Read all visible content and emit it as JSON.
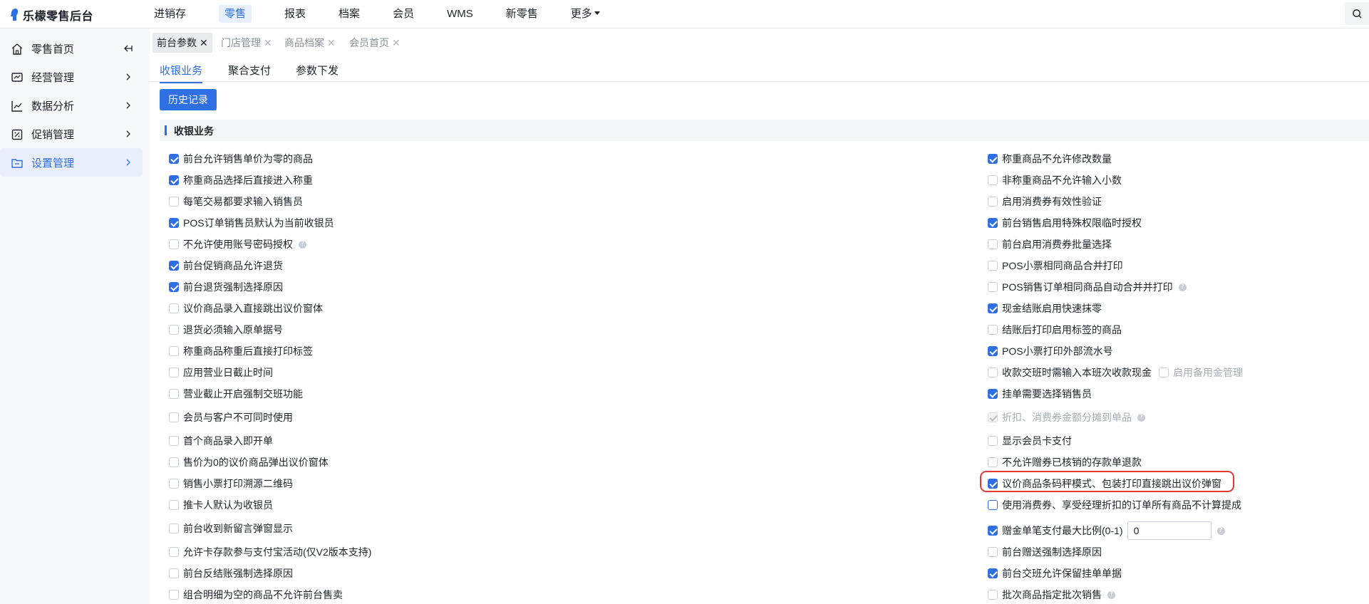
{
  "app": {
    "title": "乐檬零售后台"
  },
  "top_nav": [
    {
      "label": "进销存",
      "active": false
    },
    {
      "label": "零售",
      "active": true
    },
    {
      "label": "报表",
      "active": false
    },
    {
      "label": "档案",
      "active": false
    },
    {
      "label": "会员",
      "active": false
    },
    {
      "label": "WMS",
      "active": false
    },
    {
      "label": "新零售",
      "active": false
    },
    {
      "label": "更多",
      "active": false
    }
  ],
  "sidebar": {
    "items": [
      {
        "label": "零售首页",
        "icon": "home-icon",
        "active": false
      },
      {
        "label": "经营管理",
        "icon": "dashboard-icon",
        "active": false
      },
      {
        "label": "数据分析",
        "icon": "trend-chart-icon",
        "active": false
      },
      {
        "label": "促销管理",
        "icon": "promotion-icon",
        "active": false
      },
      {
        "label": "设置管理",
        "icon": "folder-settings-icon",
        "active": true
      }
    ]
  },
  "tabs": [
    {
      "label": "前台参数",
      "active": true
    },
    {
      "label": "门店管理",
      "active": false
    },
    {
      "label": "商品档案",
      "active": false
    },
    {
      "label": "会员首页",
      "active": false
    }
  ],
  "sub_tabs": [
    {
      "label": "收银业务",
      "active": true
    },
    {
      "label": "聚合支付",
      "active": false
    },
    {
      "label": "参数下发",
      "active": false
    }
  ],
  "history_button": "历史记录",
  "section_title": "收银业务",
  "left_options": [
    {
      "label": "前台允许销售单价为零的商品",
      "checked": true
    },
    {
      "label": "称重商品选择后直接进入称重",
      "checked": true
    },
    {
      "label": "每笔交易都要求输入销售员",
      "checked": false
    },
    {
      "label": "POS订单销售员默认为当前收银员",
      "checked": true
    },
    {
      "label": "不允许使用账号密码授权",
      "checked": false,
      "help": "?"
    },
    {
      "label": "前台促销商品允许退货",
      "checked": true
    },
    {
      "label": "前台退货强制选择原因",
      "checked": true
    },
    {
      "label": "议价商品录入直接跳出议价窗体",
      "checked": false
    },
    {
      "label": "退货必须输入原单据号",
      "checked": false
    },
    {
      "label": "称重商品称重后直接打印标签",
      "checked": false
    },
    {
      "label": "应用营业日截止时间",
      "checked": false
    },
    {
      "label": "营业截止开启强制交班功能",
      "checked": false
    },
    {
      "label": "会员与客户不可同时使用",
      "checked": false
    },
    {
      "label": "首个商品录入即开单",
      "checked": false
    },
    {
      "label": "售价为0的议价商品弹出议价窗体",
      "checked": false
    },
    {
      "label": "销售小票打印溯源二维码",
      "checked": false
    },
    {
      "label": "推卡人默认为收银员",
      "checked": false
    },
    {
      "label": "前台收到新留言弹窗显示",
      "checked": false
    },
    {
      "label": "允许卡存款参与支付宝活动(仅V2版本支持)",
      "checked": false
    },
    {
      "label": "前台反结账强制选择原因",
      "checked": false
    },
    {
      "label": "组合明细为空的商品不允许前台售卖",
      "checked": false
    }
  ],
  "right_options": [
    {
      "label": "称重商品不允许修改数量",
      "checked": true
    },
    {
      "label": "非称重商品不允许输入小数",
      "checked": false
    },
    {
      "label": "启用消费券有效性验证",
      "checked": false
    },
    {
      "label": "前台销售启用特殊权限临时授权",
      "checked": true
    },
    {
      "label": "前台启用消费券批量选择",
      "checked": false
    },
    {
      "label": "POS小票相同商品合并打印",
      "checked": false
    },
    {
      "label": "POS销售订单相同商品自动合并并打印",
      "checked": false,
      "help": "?"
    },
    {
      "label": "现金结账启用快速抹零",
      "checked": true
    },
    {
      "label": "结账后打印启用标签的商品",
      "checked": false
    },
    {
      "label": "POS小票打印外部流水号",
      "checked": true
    },
    {
      "label": "收款交班时需输入本班次收款现金",
      "checked": false,
      "sub_label": "启用备用金管理"
    },
    {
      "label": "挂单需要选择销售员",
      "checked": true
    },
    {
      "label": "折扣、消费券金额分摊到单品",
      "checked": true,
      "disabled": true,
      "help": "?"
    },
    {
      "label": "显示会员卡支付",
      "checked": false
    },
    {
      "label": "不允许赠券已核销的存款单退款",
      "checked": false
    },
    {
      "label": "议价商品条码秤模式、包装打印直接跳出议价弹窗",
      "checked": true,
      "highlighted": true
    },
    {
      "label": "使用消费券、享受经理折扣的订单所有商品不计算提成",
      "checked": false,
      "focused": true
    },
    {
      "label": "赠金单笔支付最大比例(0-1)",
      "checked": true,
      "input_value": "0",
      "help": "?"
    },
    {
      "label": "前台赠送强制选择原因",
      "checked": false
    },
    {
      "label": "前台交班允许保留挂单单据",
      "checked": true
    },
    {
      "label": "批次商品指定批次销售",
      "checked": false,
      "help": "?"
    }
  ]
}
